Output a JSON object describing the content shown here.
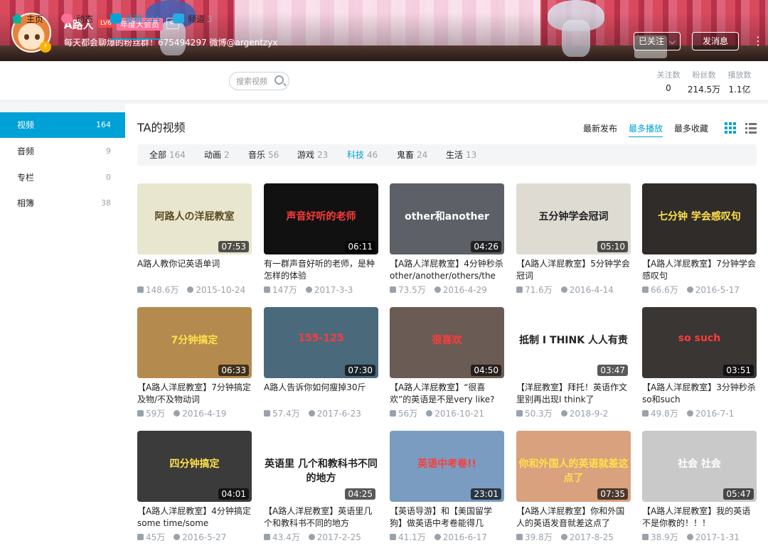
{
  "profile": {
    "username": "A路人",
    "level": "LV6",
    "vip_label": "年度大会员",
    "gender_symbol": "♂",
    "signature": "每天都会聊爆的粉丝群！675494297 微博@argentzyx",
    "follow_label": "已关注",
    "message_label": "发消息"
  },
  "nav": {
    "home": "主页",
    "dynamic": "动态",
    "posts": "投稿",
    "posts_count": "211",
    "channel": "频道",
    "channel_count": "3",
    "search_placeholder": "搜索视频"
  },
  "stats": [
    {
      "label": "关注数",
      "value": "0"
    },
    {
      "label": "粉丝数",
      "value": "214.5万"
    },
    {
      "label": "播放数",
      "value": "1.1亿"
    }
  ],
  "sidebar": [
    {
      "label": "视频",
      "count": "164"
    },
    {
      "label": "音频",
      "count": "9"
    },
    {
      "label": "专栏",
      "count": "0"
    },
    {
      "label": "相簿",
      "count": "38"
    }
  ],
  "main": {
    "title": "TA的视频",
    "sort": [
      "最新发布",
      "最多播放",
      "最多收藏"
    ],
    "filters": [
      {
        "label": "全部",
        "count": "164"
      },
      {
        "label": "动画",
        "count": "2"
      },
      {
        "label": "音乐",
        "count": "56"
      },
      {
        "label": "游戏",
        "count": "23"
      },
      {
        "label": "科技",
        "count": "46"
      },
      {
        "label": "鬼畜",
        "count": "24"
      },
      {
        "label": "生活",
        "count": "13"
      }
    ]
  },
  "videos": [
    {
      "title": "A路人教你记英语单词",
      "duration": "07:53",
      "plays": "148.6万",
      "date": "2015-10-24",
      "thumb_text": "阿路人の洋屁教室",
      "thumb_bg": "#e9e6cf",
      "thumb_fg": "#5a4a20"
    },
    {
      "title": "有一群声音好听的老师，是种怎样的体验",
      "duration": "06:11",
      "plays": "147万",
      "date": "2017-3-3",
      "thumb_text": "声音好听的老师",
      "thumb_bg": "#111111",
      "thumb_fg": "#ff3b3b"
    },
    {
      "title": "【A路人洋屁教室】4分钟秒杀other/another/others/the",
      "duration": "04:26",
      "plays": "73.5万",
      "date": "2016-4-29",
      "thumb_text": "other和another",
      "thumb_bg": "#5d6066",
      "thumb_fg": "#ffffff"
    },
    {
      "title": "【A路人洋屁教室】5分钟学会冠词",
      "duration": "05:10",
      "plays": "71.6万",
      "date": "2016-4-14",
      "thumb_text": "五分钟学会冠词",
      "thumb_bg": "#dedbd2",
      "thumb_fg": "#222222"
    },
    {
      "title": "【A路人洋屁教室】7分钟学会感叹句",
      "duration": "",
      "plays": "66.6万",
      "date": "2016-5-17",
      "thumb_text": "七分钟 学会感叹句",
      "thumb_bg": "#2f2c2a",
      "thumb_fg": "#ffe14a"
    },
    {
      "title": "【A路人洋屁教室】7分钟搞定及物/不及物动词",
      "duration": "06:33",
      "plays": "59万",
      "date": "2016-4-19",
      "thumb_text": "7分钟搞定",
      "thumb_bg": "#b58a4e",
      "thumb_fg": "#ffe14a"
    },
    {
      "title": "A路人告诉你如何瘦掉30斤",
      "duration": "07:30",
      "plays": "57.4万",
      "date": "2017-6-23",
      "thumb_text": "155-125",
      "thumb_bg": "#4a6a7c",
      "thumb_fg": "#ff3b3b"
    },
    {
      "title": "【A路人洋屁教室】“很喜欢”的英语是不是very like?",
      "duration": "04:50",
      "plays": "56万",
      "date": "2016-10-21",
      "thumb_text": "很喜欢",
      "thumb_bg": "#6b5b55",
      "thumb_fg": "#ff3b3b"
    },
    {
      "title": "【洋屁教室】拜托！英语作文里别再出现I think了",
      "duration": "03:47",
      "plays": "50.3万",
      "date": "2018-9-2",
      "thumb_text": "抵制 I THINK 人人有责",
      "thumb_bg": "#ffffff",
      "thumb_fg": "#222222"
    },
    {
      "title": "【A路人洋屁教室】3分钟秒杀so和such",
      "duration": "03:51",
      "plays": "49.8万",
      "date": "2016-7-1",
      "thumb_text": "so such",
      "thumb_bg": "#3a3634",
      "thumb_fg": "#ff3b3b"
    },
    {
      "title": "【A路人洋屁教室】4分钟搞定some time/some",
      "duration": "04:01",
      "plays": "45万",
      "date": "2016-5-27",
      "thumb_text": "四分钟搞定",
      "thumb_bg": "#3b3b3b",
      "thumb_fg": "#ffe14a"
    },
    {
      "title": "【A路人洋屁教室】英语里几个和教科书不同的地方",
      "duration": "04:25",
      "plays": "43.4万",
      "date": "2017-2-25",
      "thumb_text": "英语里 几个和教科书不同 的地方",
      "thumb_bg": "#ffffff",
      "thumb_fg": "#222222"
    },
    {
      "title": "【英语导游】和【美国留学狗】做英语中考卷能得几分？！",
      "duration": "23:01",
      "plays": "41.1万",
      "date": "2016-6-17",
      "thumb_text": "英语中考卷!!",
      "thumb_bg": "#7a9cc0",
      "thumb_fg": "#ff3b3b"
    },
    {
      "title": "【A路人洋屁教室】你和外国人的英语发音就差这点了",
      "duration": "07:35",
      "plays": "39.8万",
      "date": "2017-8-25",
      "thumb_text": "你和外国人的英语就差这点了",
      "thumb_bg": "#d9a17e",
      "thumb_fg": "#ffe14a"
    },
    {
      "title": "【A路人洋屁教室】我的英语不是你教的！！！",
      "duration": "05:47",
      "plays": "38.9万",
      "date": "2017-1-31",
      "thumb_text": "社会 社会",
      "thumb_bg": "#c9c9c9",
      "thumb_fg": "#ffffff"
    }
  ],
  "colors": {
    "accent": "#00a1d6",
    "vip": "#fb7299"
  }
}
